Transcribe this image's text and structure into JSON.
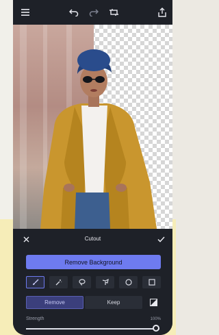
{
  "toolbar": {
    "icons": [
      "menu-icon",
      "undo-icon",
      "redo-icon",
      "crop-icon",
      "share-icon"
    ]
  },
  "panel": {
    "title": "Cutout",
    "remove_background_label": "Remove Background",
    "tools": [
      "brush-icon",
      "magic-wand-icon",
      "lasso-icon",
      "shape-icon",
      "circle-icon",
      "square-icon"
    ],
    "active_tool": "brush-icon",
    "mode_remove_label": "Remove",
    "mode_keep_label": "Keep",
    "active_mode": "Remove",
    "strength_label": "Strength",
    "strength_value": "100%",
    "strength_fraction": 1.0
  },
  "colors": {
    "accent": "#6e7bf0",
    "panel_bg": "#1e2128"
  }
}
